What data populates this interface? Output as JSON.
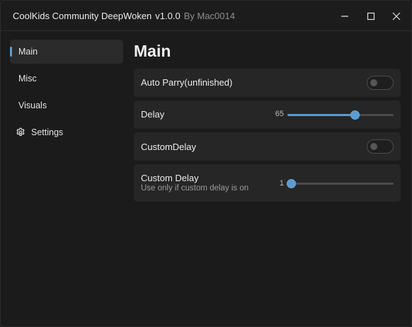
{
  "window": {
    "title": "CoolKids Community DeepWoken",
    "version": "v1.0.0",
    "author": "By Mac0014"
  },
  "sidebar": {
    "items": [
      {
        "label": "Main",
        "active": true
      },
      {
        "label": "Misc"
      },
      {
        "label": "Visuals"
      },
      {
        "label": "Settings",
        "icon": "gear-icon"
      }
    ]
  },
  "main": {
    "title": "Main",
    "auto_parry": {
      "label": "Auto Parry(unfinished)",
      "enabled": false
    },
    "delay": {
      "label": "Delay",
      "value": "65",
      "fraction": 0.63
    },
    "custom_delay_toggle": {
      "label": "CustomDelay",
      "enabled": false
    },
    "custom_delay": {
      "label": "Custom Delay",
      "description": "Use only if custom delay is on",
      "value": "1",
      "fraction": 0.0
    }
  },
  "colors": {
    "accent": "#5a9bd0",
    "background": "#1b1b1b",
    "card": "#262626"
  }
}
